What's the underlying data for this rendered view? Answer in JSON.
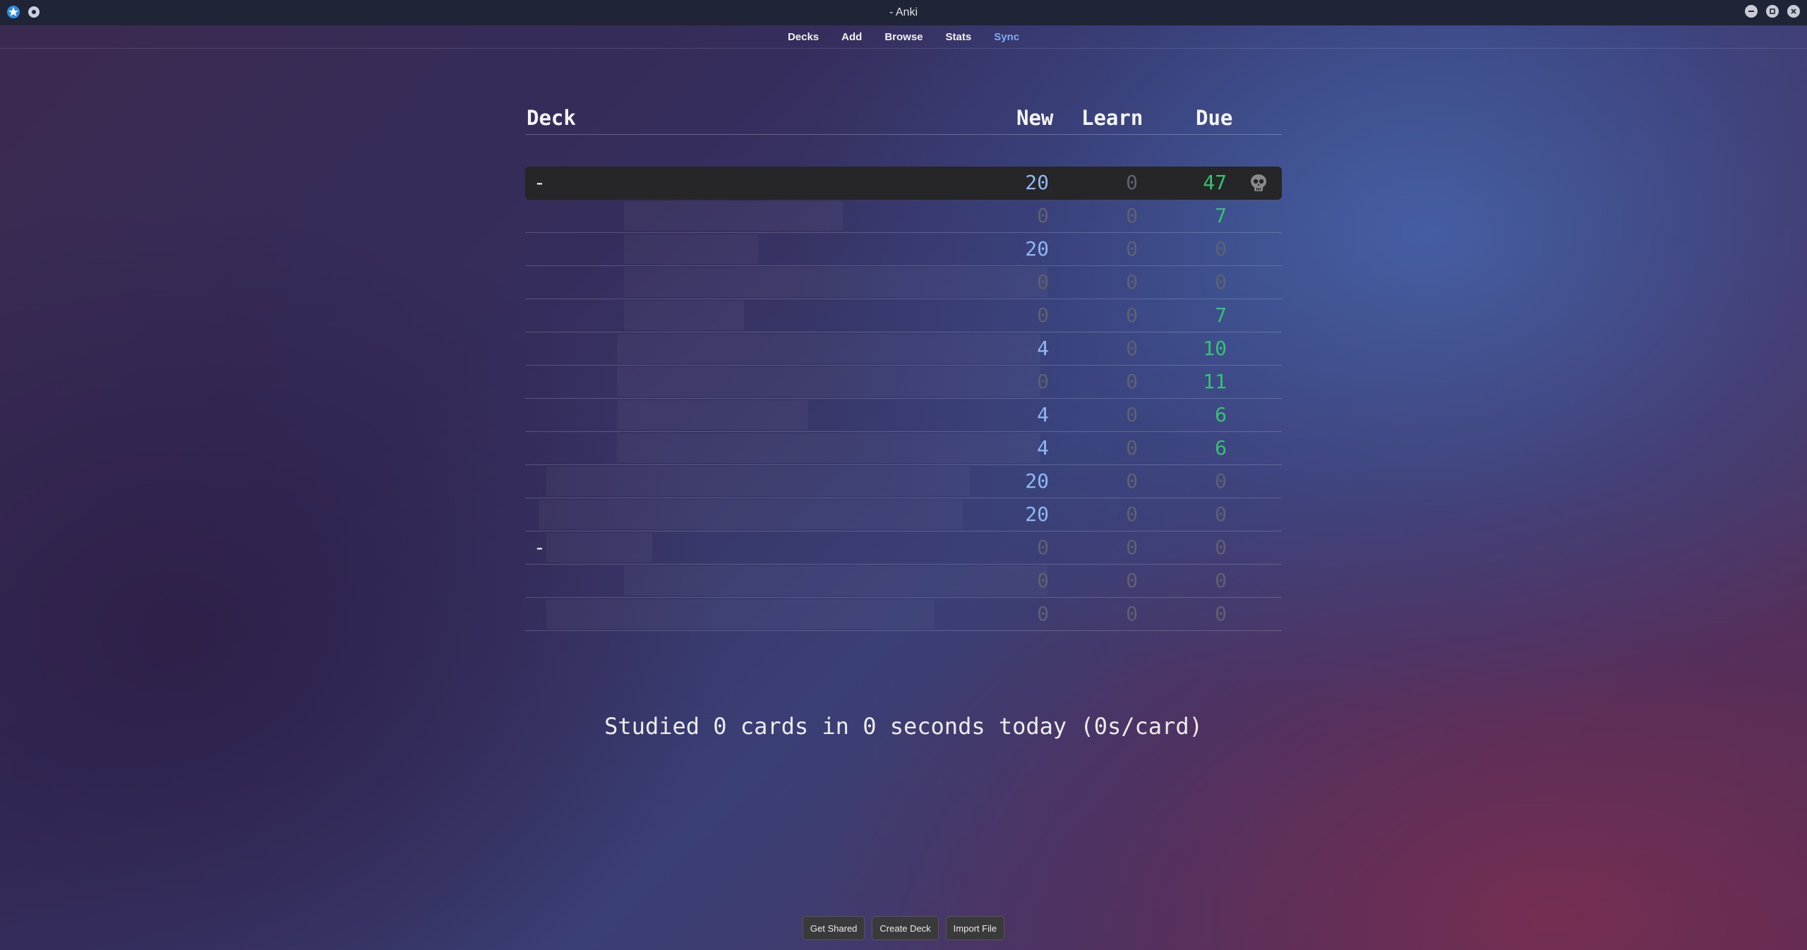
{
  "window": {
    "title": "- Anki"
  },
  "toolbar": {
    "decks": "Decks",
    "add": "Add",
    "browse": "Browse",
    "stats": "Stats",
    "sync": "Sync",
    "sync_color": "#86a8f2"
  },
  "table": {
    "headers": {
      "deck": "Deck",
      "new": "New",
      "learn": "Learn",
      "due": "Due"
    },
    "rows": [
      {
        "collapse": "-",
        "new": "20",
        "learn": "0",
        "due": "47",
        "current": true
      },
      {
        "collapse": "",
        "new": "0",
        "learn": "0",
        "due": "7"
      },
      {
        "collapse": "",
        "new": "20",
        "learn": "0",
        "due": "0"
      },
      {
        "collapse": "",
        "new": "0",
        "learn": "0",
        "due": "0"
      },
      {
        "collapse": "",
        "new": "0",
        "learn": "0",
        "due": "7"
      },
      {
        "collapse": "",
        "new": "4",
        "learn": "0",
        "due": "10"
      },
      {
        "collapse": "",
        "new": "0",
        "learn": "0",
        "due": "11"
      },
      {
        "collapse": "",
        "new": "4",
        "learn": "0",
        "due": "6"
      },
      {
        "collapse": "",
        "new": "4",
        "learn": "0",
        "due": "6"
      },
      {
        "collapse": "",
        "new": "20",
        "learn": "0",
        "due": "0"
      },
      {
        "collapse": "",
        "new": "20",
        "learn": "0",
        "due": "0"
      },
      {
        "collapse": "-",
        "new": "0",
        "learn": "0",
        "due": "0"
      },
      {
        "collapse": "",
        "new": "0",
        "learn": "0",
        "due": "0"
      },
      {
        "collapse": "",
        "new": "0",
        "learn": "0",
        "due": "0"
      }
    ]
  },
  "studied": "Studied 0 cards in 0 seconds today (0s/card)",
  "buttons": {
    "get_shared": "Get Shared",
    "create_deck": "Create Deck",
    "import_file": "Import File"
  },
  "colors": {
    "new": "#8fb8f2",
    "due": "#35c271",
    "zero": "#5f6170"
  },
  "icons": {
    "app": "anki-star-icon",
    "pin": "pin-icon",
    "deck_options": "skull-gear-icon",
    "minimize": "minimize-icon",
    "maximize": "maximize-icon",
    "close": "close-icon"
  }
}
